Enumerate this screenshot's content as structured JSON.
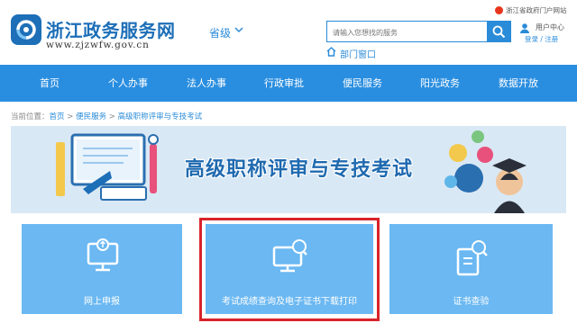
{
  "header": {
    "site_name": "浙江政务服务网",
    "site_url": "www.zjzwfw.gov.cn",
    "region": "省级",
    "search": {
      "placeholder": "请输入您想找的服务"
    },
    "department_link": "部门窗口",
    "gov_portal": "浙江省政府门户网站",
    "user_center": "用户中心",
    "login": "登录",
    "register": "注册",
    "login_separator": " / "
  },
  "nav": {
    "items": [
      {
        "label": "首页"
      },
      {
        "label": "个人办事"
      },
      {
        "label": "法人办事"
      },
      {
        "label": "行政审批"
      },
      {
        "label": "便民服务"
      },
      {
        "label": "阳光政务"
      },
      {
        "label": "数据开放"
      }
    ]
  },
  "breadcrumb": {
    "prefix": "当前位置：",
    "items": [
      "首页",
      "便民服务",
      "高级职称评审与专技考试"
    ],
    "separator": " > "
  },
  "banner": {
    "title": "高级职称评审与专技考试"
  },
  "cards": [
    {
      "label": "网上申报",
      "icon": "upload-monitor-icon"
    },
    {
      "label": "考试成绩查询及电子证书下载打印",
      "icon": "search-monitor-icon"
    },
    {
      "label": "证书查验",
      "icon": "certificate-search-icon"
    }
  ],
  "colors": {
    "primary": "#2a8ee0",
    "card": "#6bb8f2",
    "highlight": "#d8232a",
    "banner_bg": "#d9e8f5"
  }
}
